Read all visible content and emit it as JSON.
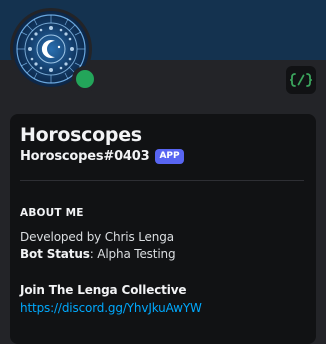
{
  "profile": {
    "display_name": "Horoscopes",
    "username": "Horoscopes#0403",
    "app_badge": "APP",
    "status": "online",
    "status_color": "#23a55a",
    "banner_color": "#14324f",
    "avatar_icon": "zodiac-wheel-icon",
    "dev_badge_icon": "active-developer-icon"
  },
  "about": {
    "heading": "ABOUT ME",
    "developed_by": "Developed by Chris Lenga",
    "bot_status_label": "Bot Status",
    "bot_status_value": ": Alpha Testing",
    "join_text": "Join The Lenga Collective",
    "invite_link": "https://discord.gg/YhvJkuAwYW"
  }
}
